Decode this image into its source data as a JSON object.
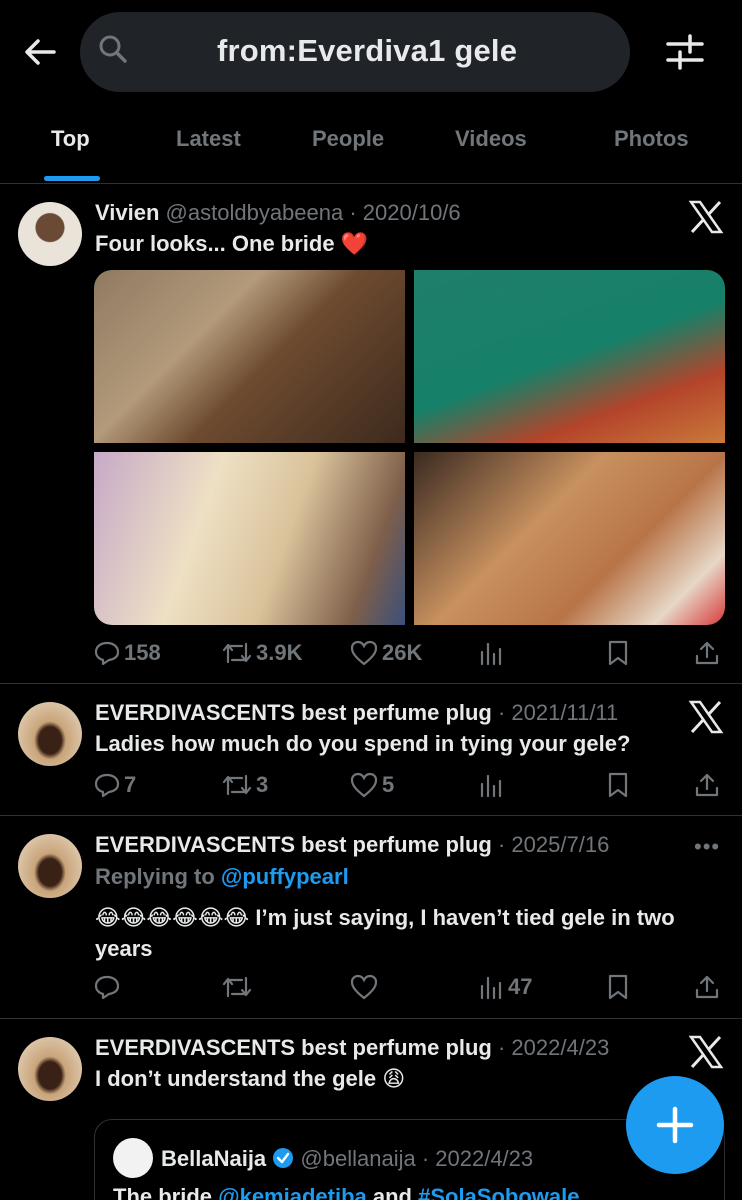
{
  "search": {
    "query": "from:Everdiva1 gele"
  },
  "tabs": [
    {
      "label": "Top"
    },
    {
      "label": "Latest"
    },
    {
      "label": "People"
    },
    {
      "label": "Videos"
    },
    {
      "label": "Photos"
    }
  ],
  "tweets": [
    {
      "name": "Vivien",
      "meta": "@astoldbyabeena · 2020/10/6",
      "text": "Four looks... One bride ❤️",
      "replies": "158",
      "retweets": "3.9K",
      "likes": "26K",
      "views": ""
    },
    {
      "name": "EVERDIVASCENTS best perfume plug",
      "meta": " · 2021/11/11",
      "text": "Ladies how much do you spend in tying your gele?",
      "replies": "7",
      "retweets": "3",
      "likes": "5",
      "views": ""
    },
    {
      "name": "EVERDIVASCENTS best perfume plug",
      "meta": " · 2025/7/16",
      "replying_prefix": "Replying to ",
      "replying_handle": "@puffypearl",
      "text": "😂😂😂😂😂😂 I’m just saying, I haven’t tied gele in two years",
      "replies": "",
      "retweets": "",
      "likes": "",
      "views": "47",
      "more": "•••"
    },
    {
      "name": "EVERDIVASCENTS best perfume plug",
      "meta": " · 2022/4/23",
      "text": "I don’t understand the gele 😩",
      "quote": {
        "name": "BellaNaija",
        "meta": " @bellanaija · 2022/4/23",
        "text_prefix": "The bride ",
        "mention": "@kemiadetiba",
        "text_mid": " and ",
        "hashtag": "#SolaSobowale"
      }
    }
  ],
  "colors": {
    "accent": "#1d9bf0",
    "background": "#000000",
    "muted": "#71767b",
    "search_bg": "#202327"
  },
  "icons": [
    "back-arrow-icon",
    "search-icon",
    "filter-sliders-icon",
    "x-logo-icon",
    "reply-icon",
    "retweet-icon",
    "like-icon",
    "views-icon",
    "bookmark-icon",
    "share-icon",
    "more-icon",
    "verified-icon",
    "compose-plus-icon"
  ]
}
